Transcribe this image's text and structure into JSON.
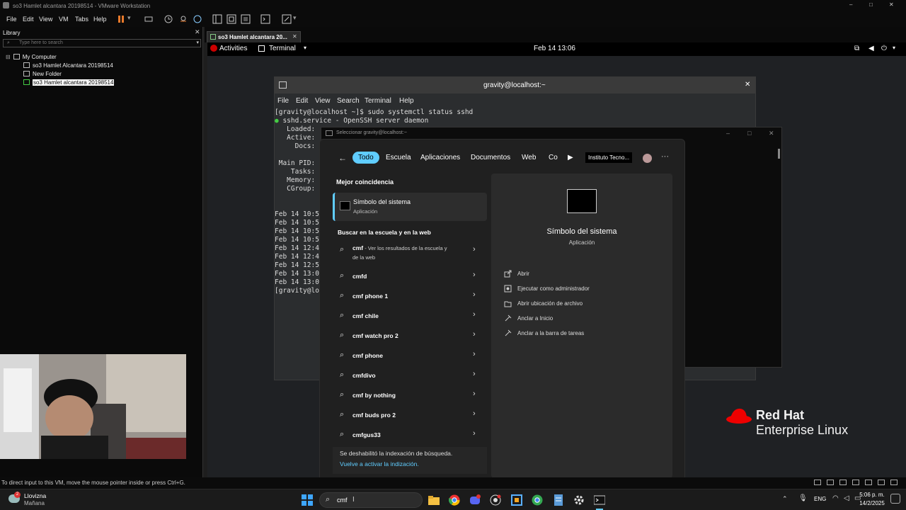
{
  "window": {
    "title": "so3 Hamlet alcantara 20198514 - VMware Workstation"
  },
  "menubar": {
    "items": [
      "File",
      "Edit",
      "View",
      "VM",
      "Tabs",
      "Help"
    ]
  },
  "library": {
    "title": "Library",
    "search_placeholder": "Type here to search",
    "tree": [
      "My Computer",
      "so3 Hamlet Alcantara 20198514",
      "New Folder",
      "so3  Hamlet alcantara 20198514"
    ]
  },
  "vm_tab": {
    "label": "so3 Hamlet alcantara 20..."
  },
  "gnome": {
    "activities": "Activities",
    "app": "Terminal",
    "clock": "Feb 14  13:06"
  },
  "terminal": {
    "title": "gravity@localhost:~",
    "menu": [
      "File",
      "Edit",
      "View",
      "Search",
      "Terminal",
      "Help"
    ],
    "lines": [
      "[gravity@localhost ~]$ sudo systemctl status sshd",
      "● sshd.service - OpenSSH server daemon",
      "   Loaded:",
      "   Active:",
      "     Docs:",
      "",
      " Main PID:",
      "    Tasks:",
      "   Memory:",
      "   CGroup:",
      "",
      "",
      "Feb 14 10:5",
      "Feb 14 10:5",
      "Feb 14 10:5",
      "Feb 14 10:5",
      "Feb 14 12:4",
      "Feb 14 12:4",
      "Feb 14 12:5",
      "Feb 14 13:0",
      "Feb 14 13:0",
      "[gravity@lo"
    ]
  },
  "cmd_window": {
    "title": "Seleccionar gravity@localhost:~"
  },
  "search": {
    "filters": [
      "Todo",
      "Escuela",
      "Aplicaciones",
      "Documentos",
      "Web",
      "Co"
    ],
    "org": "Instituto Tecno...",
    "best_match_header": "Mejor coincidencia",
    "best_match": {
      "name": "Símbolo del sistema",
      "type": "Aplicación"
    },
    "web_header": "Buscar en la escuela y en la web",
    "suggestions": [
      {
        "bold": "cmf",
        "rest": " - Ver los resultados de la escuela y",
        "rest2": "de la web"
      },
      {
        "bold": "cmfd",
        "rest": ""
      },
      {
        "bold": "cmf phone 1",
        "rest": ""
      },
      {
        "bold": "cmf chile",
        "rest": ""
      },
      {
        "bold": "cmf watch pro 2",
        "rest": ""
      },
      {
        "bold": "cmf phone",
        "rest": ""
      },
      {
        "bold": "cmfdivo",
        "rest": ""
      },
      {
        "bold": "cmf by nothing",
        "rest": ""
      },
      {
        "bold": "cmf buds pro 2",
        "rest": ""
      },
      {
        "bold": "cmfgus33",
        "rest": ""
      }
    ],
    "index_notice": "Se deshabilitó la indexación de búsqueda.",
    "index_link": "Vuelve a activar la indización.",
    "detail": {
      "name": "Símbolo del sistema",
      "type": "Aplicación",
      "actions": [
        "Abrir",
        "Ejecutar como administrador",
        "Abrir ubicación de archivo",
        "Anclar a Inicio",
        "Anclar a la barra de tareas"
      ]
    }
  },
  "watermark": {
    "line1": "Red Hat",
    "line2": "Enterprise Linux"
  },
  "status": {
    "hint": "To direct input to this VM, move the mouse pointer inside or press Ctrl+G."
  },
  "taskbar": {
    "weather_title": "Llovizna",
    "weather_sub": "Mañana",
    "weather_badge": "2",
    "search_value": "cmf",
    "lang": "ENG",
    "time": "5:06 p. m.",
    "date": "14/2/2025"
  },
  "colors": {
    "accent": "#60cdff",
    "redhat": "#ee0000",
    "vm_pause": "#e8792b"
  }
}
